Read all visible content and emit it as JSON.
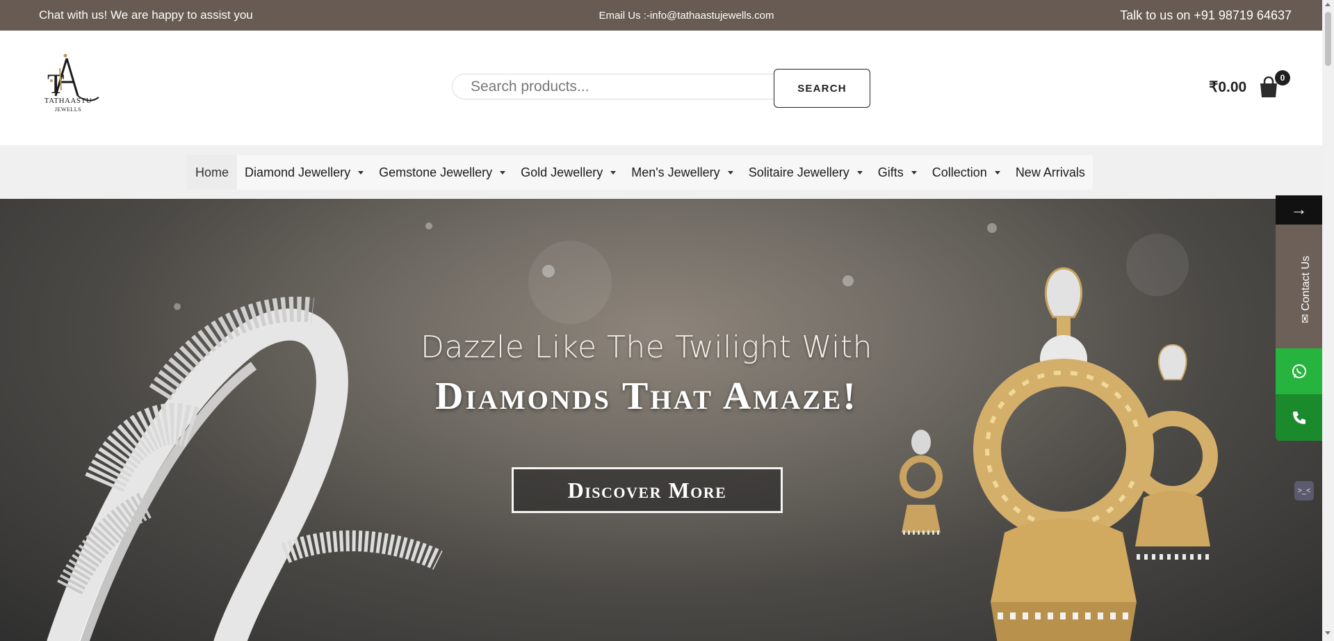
{
  "topbar": {
    "chat_text": "Chat with us! We are happy to assist you",
    "email_text": "Email Us :-info@tathaastujewells.com",
    "phone_text": "Talk to us on +91 98719 64637",
    "background_color": "#675b53"
  },
  "header": {
    "logo_alt": "Tathaastu Jewells logo",
    "logo_text": "TATHAASTU",
    "logo_subtext": "JEWELLS",
    "search": {
      "placeholder": "Search products...",
      "value": "",
      "button_label": "SEARCH"
    },
    "cart": {
      "amount": "₹0.00",
      "count": "0",
      "icon": "shopping-bag-icon"
    }
  },
  "nav": {
    "items": [
      {
        "label": "Home",
        "has_dropdown": false,
        "active": true
      },
      {
        "label": "Diamond Jewellery",
        "has_dropdown": true
      },
      {
        "label": "Gemstone Jewellery",
        "has_dropdown": true
      },
      {
        "label": "Gold Jewellery",
        "has_dropdown": true
      },
      {
        "label": "Men's Jewellery",
        "has_dropdown": true
      },
      {
        "label": "Solitaire Jewellery",
        "has_dropdown": true
      },
      {
        "label": "Gifts",
        "has_dropdown": true
      },
      {
        "label": "Collection",
        "has_dropdown": true
      },
      {
        "label": "New Arrivals",
        "has_dropdown": false
      }
    ]
  },
  "hero": {
    "line1": "Dazzle Like The Twilight With",
    "line2": "Diamonds That Amaze!",
    "button_label": "Discover More"
  },
  "side_widget": {
    "arrow_icon": "arrow-right-icon",
    "contact_label": "Contact Us",
    "contact_icon": "mail-icon",
    "whatsapp_icon": "whatsapp-icon",
    "phone_icon": "phone-icon",
    "colors": {
      "contact": "#6d6058",
      "whatsapp": "#27b43e",
      "phone": "#1b8a2c"
    }
  }
}
